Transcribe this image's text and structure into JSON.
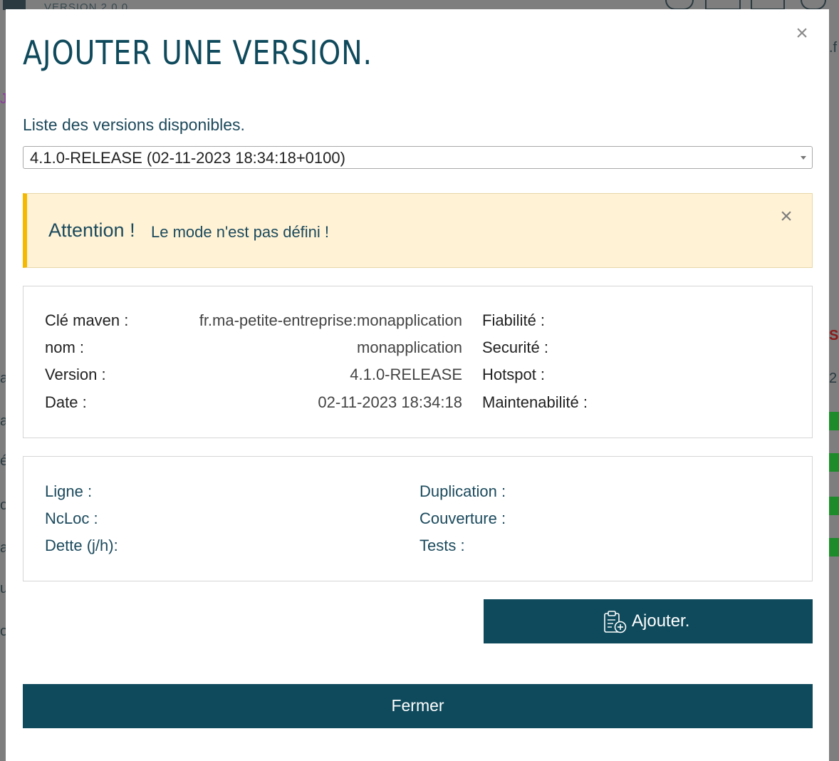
{
  "background": {
    "version_text": "VERSION 2.0.0"
  },
  "modal": {
    "title": "AJOUTER UNE VERSION.",
    "close_symbol": "×",
    "list_label": "Liste des versions disponibles.",
    "version_select": {
      "selected": "4.1.0-RELEASE (02-11-2023 18:34:18+0100)"
    },
    "alert": {
      "strong": "Attention !",
      "message": "Le mode n'est pas défini !",
      "close_symbol": "×",
      "color_border": "#f5b900",
      "color_background": "#fff2d5"
    },
    "info": {
      "maven_key_label": "Clé maven :",
      "maven_key_value": "fr.ma-petite-entreprise:monapplication",
      "name_label": "nom :",
      "name_value": "monapplication",
      "version_label": "Version :",
      "version_value": "4.1.0-RELEASE",
      "date_label": "Date :",
      "date_value": "02-11-2023 18:34:18",
      "fiabilite_label": "Fiabilité :",
      "securite_label": "Securité :",
      "hotspot_label": "Hotspot :",
      "maintenabilite_label": "Maintenabilité :"
    },
    "metrics": {
      "ligne_label": "Ligne :",
      "ncloc_label": "NcLoc :",
      "dette_label": "Dette (j/h):",
      "duplication_label": "Duplication :",
      "couverture_label": "Couverture :",
      "tests_label": "Tests :"
    },
    "add_button": {
      "label": "Ajouter.",
      "icon": "clipboard-add-icon"
    },
    "close_button": {
      "label": "Fermer"
    },
    "accent_color": "#0f4a5c"
  }
}
